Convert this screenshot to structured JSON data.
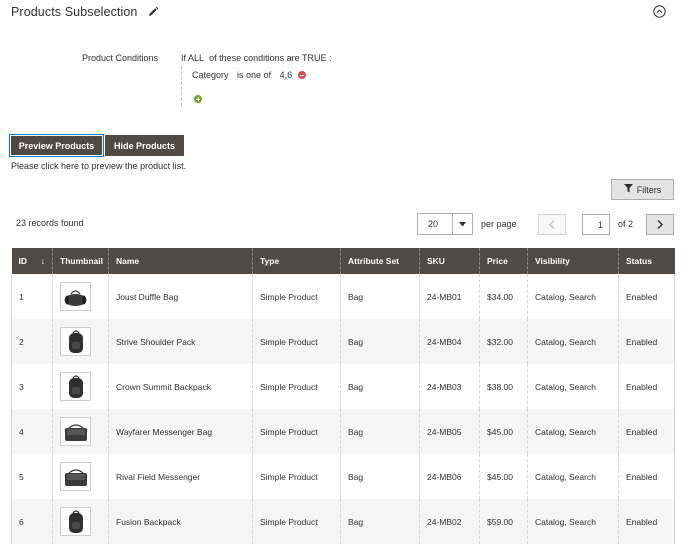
{
  "header": {
    "title": "Products Subselection"
  },
  "conditions": {
    "label": "Product Conditions",
    "if_text": "If",
    "aggregator": "ALL",
    "of_text": "of these conditions are",
    "value": "TRUE",
    "colon": ":",
    "rule_attribute": "Category",
    "rule_operator": "is one of",
    "rule_value": "4,6"
  },
  "buttons": {
    "preview": "Preview Products",
    "hide": "Hide Products"
  },
  "hint": "Please click here to preview the product list.",
  "toolbar": {
    "filters": "Filters",
    "records": "23 records found",
    "per_page_value": "20",
    "per_page_label": "per page",
    "current_page": "1",
    "of_pages": "of 2"
  },
  "grid": {
    "columns": [
      "ID",
      "Thumbnail",
      "Name",
      "Type",
      "Attribute Set",
      "SKU",
      "Price",
      "Visibility",
      "Status"
    ],
    "sort_indicator": "↓",
    "rows": [
      {
        "id": "1",
        "thumb": "duffle-bag",
        "name": "Joust Duffle Bag",
        "type": "Simple Product",
        "set": "Bag",
        "sku": "24-MB01",
        "price": "$34.00",
        "visibility": "Catalog, Search",
        "status": "Enabled"
      },
      {
        "id": "2",
        "thumb": "backpack",
        "name": "Strive Shoulder Pack",
        "type": "Simple Product",
        "set": "Bag",
        "sku": "24-MB04",
        "price": "$32.00",
        "visibility": "Catalog, Search",
        "status": "Enabled"
      },
      {
        "id": "3",
        "thumb": "backpack",
        "name": "Crown Summit Backpack",
        "type": "Simple Product",
        "set": "Bag",
        "sku": "24-MB03",
        "price": "$38.00",
        "visibility": "Catalog, Search",
        "status": "Enabled"
      },
      {
        "id": "4",
        "thumb": "messenger-bag",
        "name": "Wayfarer Messenger Bag",
        "type": "Simple Product",
        "set": "Bag",
        "sku": "24-MB05",
        "price": "$45.00",
        "visibility": "Catalog, Search",
        "status": "Enabled"
      },
      {
        "id": "5",
        "thumb": "messenger-bag",
        "name": "Rival Field Messenger",
        "type": "Simple Product",
        "set": "Bag",
        "sku": "24-MB06",
        "price": "$45.00",
        "visibility": "Catalog, Search",
        "status": "Enabled"
      },
      {
        "id": "6",
        "thumb": "backpack",
        "name": "Fusion Backpack",
        "type": "Simple Product",
        "set": "Bag",
        "sku": "24-MB02",
        "price": "$59.00",
        "visibility": "Catalog, Search",
        "status": "Enabled"
      }
    ]
  },
  "colors": {
    "accent": "#514943",
    "focus": "#007bdb",
    "remove": "#e14b4b",
    "add": "#79a22e"
  }
}
